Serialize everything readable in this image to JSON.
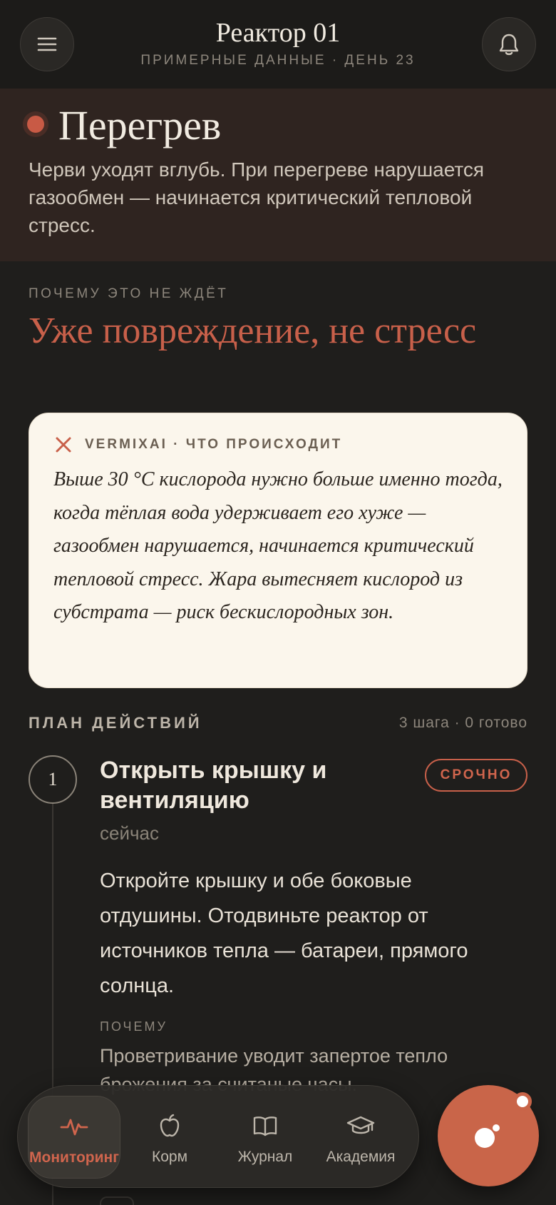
{
  "header": {
    "title": "Реактор 01",
    "subtitle": "ПРИМЕРНЫЕ ДАННЫЕ · ДЕНЬ 23",
    "menu_icon": "hamburger-menu-icon",
    "bell_icon": "bell-icon"
  },
  "alert": {
    "title": "Перегрев",
    "text": "Черви уходят вглубь. При перегреве нарушается газообмен — начинается критический тепловой стресс.",
    "dot_color": "#c85a45"
  },
  "why": {
    "label": "ПОЧЕМУ ЭТО НЕ ЖДЁТ",
    "title": "Уже повреждение, не стресс"
  },
  "ai_card": {
    "label": "VERMIXAI · ЧТО ПРОИСХОДИТ",
    "text": "Выше 30 °C кислорода нужно больше именно тогда, когда тёплая вода удерживает его хуже — газообмен нарушается, начинается критический тепловой стресс. Жара вытесняет кислород из субстрата — риск бескислородных зон."
  },
  "plan": {
    "heading": "ПЛАН ДЕЙСТВИЙ",
    "meta": "3 шага · 0 готово",
    "steps": [
      {
        "number": "1",
        "title": "Открыть крышку и вентиляцию",
        "badge": "СРОЧНО",
        "time": "сейчас",
        "text": "Откройте крышку и обе боковые отдушины. Отодвиньте реактор от источников тепла — батареи, прямого солнца.",
        "why_label": "ПОЧЕМУ",
        "why_text": "Проветривание уводит запертое тепло брожения за считаные часы."
      }
    ]
  },
  "nav": {
    "items": [
      {
        "label": "Мониторинг",
        "icon": "pulse-icon",
        "active": true
      },
      {
        "label": "Корм",
        "icon": "apple-icon",
        "active": false
      },
      {
        "label": "Журнал",
        "icon": "book-icon",
        "active": false
      },
      {
        "label": "Академия",
        "icon": "graduation-cap-icon",
        "active": false
      }
    ]
  },
  "colors": {
    "accent": "#c8604a",
    "background": "#1f1e1c",
    "card": "#fbf6ec"
  }
}
